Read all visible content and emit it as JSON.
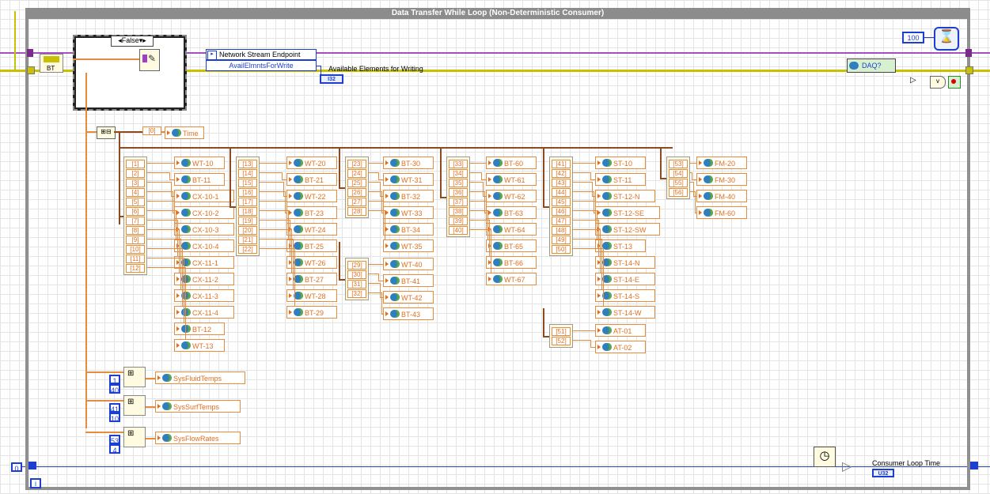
{
  "loop": {
    "title": "Data Transfer While Loop (Non-Deterministic Consumer)"
  },
  "case_structure": {
    "selector": "False"
  },
  "stream": {
    "title": "Network Stream Endpoint",
    "property": "AvailElmntsForWrite",
    "output_label": "Available Elements for Writing",
    "type": "I32"
  },
  "wait_const": "100",
  "daq_label": "DAQ?",
  "bt_label": "BT",
  "time_index": "[0]",
  "time_label": "Time",
  "groups": [
    {
      "indices": [
        "[1]",
        "[2]",
        "[3]",
        "[4]",
        "[5]",
        "[6]",
        "[7]",
        "[8]",
        "[9]",
        "[10]",
        "[11]",
        "[12]"
      ],
      "names": [
        "WT-10",
        "BT-11",
        "CX-10-1",
        "CX-10-2",
        "CX-10-3",
        "CX-10-4",
        "CX-11-1",
        "CX-11-2",
        "CX-11-3",
        "CX-11-4",
        "BT-12",
        "WT-13"
      ]
    },
    {
      "indices": [
        "[13]",
        "[14]",
        "[15]",
        "[16]",
        "[17]",
        "[18]",
        "[19]",
        "[20]",
        "[21]",
        "[22]"
      ],
      "names": [
        "WT-20",
        "BT-21",
        "WT-22",
        "BT-23",
        "WT-24",
        "BT-25",
        "WT-26",
        "BT-27",
        "WT-28",
        "BT-29"
      ]
    },
    {
      "indices": [
        "[23]",
        "[24]",
        "[25]",
        "[26]",
        "[27]",
        "[28]"
      ],
      "names": [
        "BT-30",
        "WT-31",
        "BT-32",
        "WT-33",
        "BT-34",
        "WT-35"
      ]
    },
    {
      "indices": [
        "[29]",
        "[30]",
        "[31]",
        "[32]"
      ],
      "names": [
        "WT-40",
        "BT-41",
        "WT-42",
        "BT-43"
      ]
    },
    {
      "indices": [
        "[33]",
        "[34]",
        "[35]",
        "[36]",
        "[37]",
        "[38]",
        "[39]",
        "[40]"
      ],
      "names": [
        "BT-60",
        "WT-61",
        "WT-62",
        "BT-63",
        "WT-64",
        "BT-65",
        "BT-66",
        "WT-67"
      ]
    },
    {
      "indices": [
        "[41]",
        "[42]",
        "[43]",
        "[44]",
        "[45]",
        "[46]",
        "[47]",
        "[48]",
        "[49]",
        "[50]"
      ],
      "names": [
        "ST-10",
        "ST-11",
        "ST-12-N",
        "ST-12-SE",
        "ST-12-SW",
        "ST-13",
        "ST-14-N",
        "ST-14-E",
        "ST-14-S",
        "ST-14-W"
      ]
    },
    {
      "indices": [
        "[51]",
        "[52]"
      ],
      "names": [
        "AT-01",
        "AT-02"
      ]
    },
    {
      "indices": [
        "[53]",
        "[54]",
        "[55]",
        "[56]"
      ],
      "names": [
        "FM-20",
        "FM-30",
        "FM-40",
        "FM-60"
      ]
    }
  ],
  "subsets": [
    {
      "start": "1",
      "len": "40",
      "label": "SysFluidTemps"
    },
    {
      "start": "41",
      "len": "10",
      "label": "SysSurfTemps"
    },
    {
      "start": "53",
      "len": "4",
      "label": "SysFlowRates"
    }
  ],
  "iteration_const": "0",
  "iteration_terminal": "i",
  "loop_time": {
    "label": "Consumer Loop Time",
    "type": "U32"
  },
  "colors": {
    "orange": "#e78b3e",
    "blue": "#1d3fd0",
    "brown": "#8e4a1c",
    "loop_border": "#909090"
  },
  "icons": [
    "metronome-icon",
    "clock-icon",
    "globe-icon",
    "stop-icon",
    "bundle-icon"
  ]
}
